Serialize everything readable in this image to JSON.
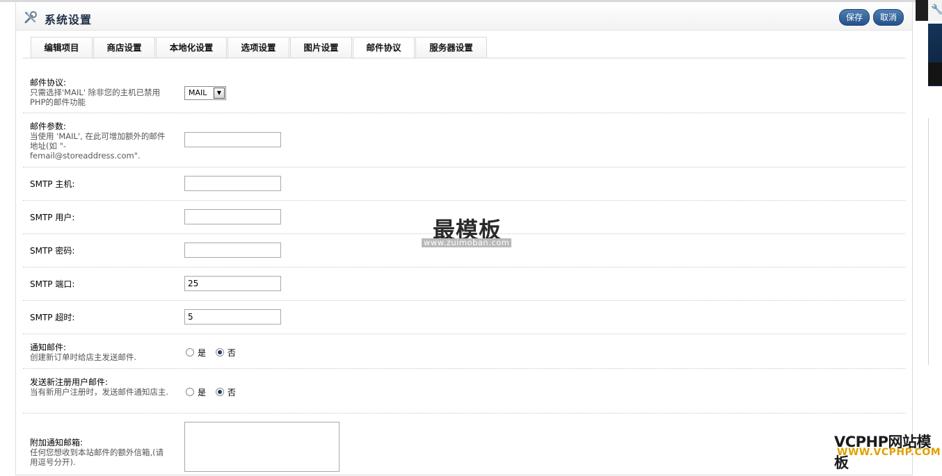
{
  "header": {
    "title": "系统设置",
    "save_label": "保存",
    "cancel_label": "取消"
  },
  "tabs": [
    "编辑项目",
    "商店设置",
    "本地化设置",
    "选项设置",
    "图片设置",
    "邮件协议",
    "服务器设置"
  ],
  "active_tab": "邮件协议",
  "form": {
    "mail_protocol": {
      "label": "邮件协议:",
      "help": "只需选择'MAIL' 除非您的主机已禁用PHP的邮件功能",
      "value": "MAIL"
    },
    "mail_parameter": {
      "label": "邮件参数:",
      "help": "当使用 'MAIL', 在此可增加额外的邮件地址(如 \"-femail@storeaddress.com\".",
      "value": ""
    },
    "smtp_host": {
      "label": "SMTP 主机:",
      "value": ""
    },
    "smtp_user": {
      "label": "SMTP 用户:",
      "value": ""
    },
    "smtp_password": {
      "label": "SMTP 密码:",
      "value": ""
    },
    "smtp_port": {
      "label": "SMTP 端口:",
      "value": "25"
    },
    "smtp_timeout": {
      "label": "SMTP 超时:",
      "value": "5"
    },
    "alert_mail": {
      "label": "通知邮件:",
      "help": "创建新订单时给店主发送邮件.",
      "yes": "是",
      "no": "否",
      "selected": "否"
    },
    "account_mail": {
      "label": "发送新注册用户邮件:",
      "help": "当有新用户注册时，发送邮件通知店主.",
      "yes": "是",
      "no": "否",
      "selected": "否"
    },
    "alert_emails": {
      "label": "附加通知邮箱:",
      "help": "任何您想收到本站邮件的额外信箱,(请用逗号分开)."
    }
  },
  "watermark": {
    "title": "最模板",
    "url": "www.zuimoban.com"
  },
  "brand": {
    "name": "VCPHP网站模板",
    "url": "WWW.VCPHP.COM"
  },
  "icons": [
    "tools-icon",
    "chevron-down-icon",
    "wrench-icon"
  ]
}
